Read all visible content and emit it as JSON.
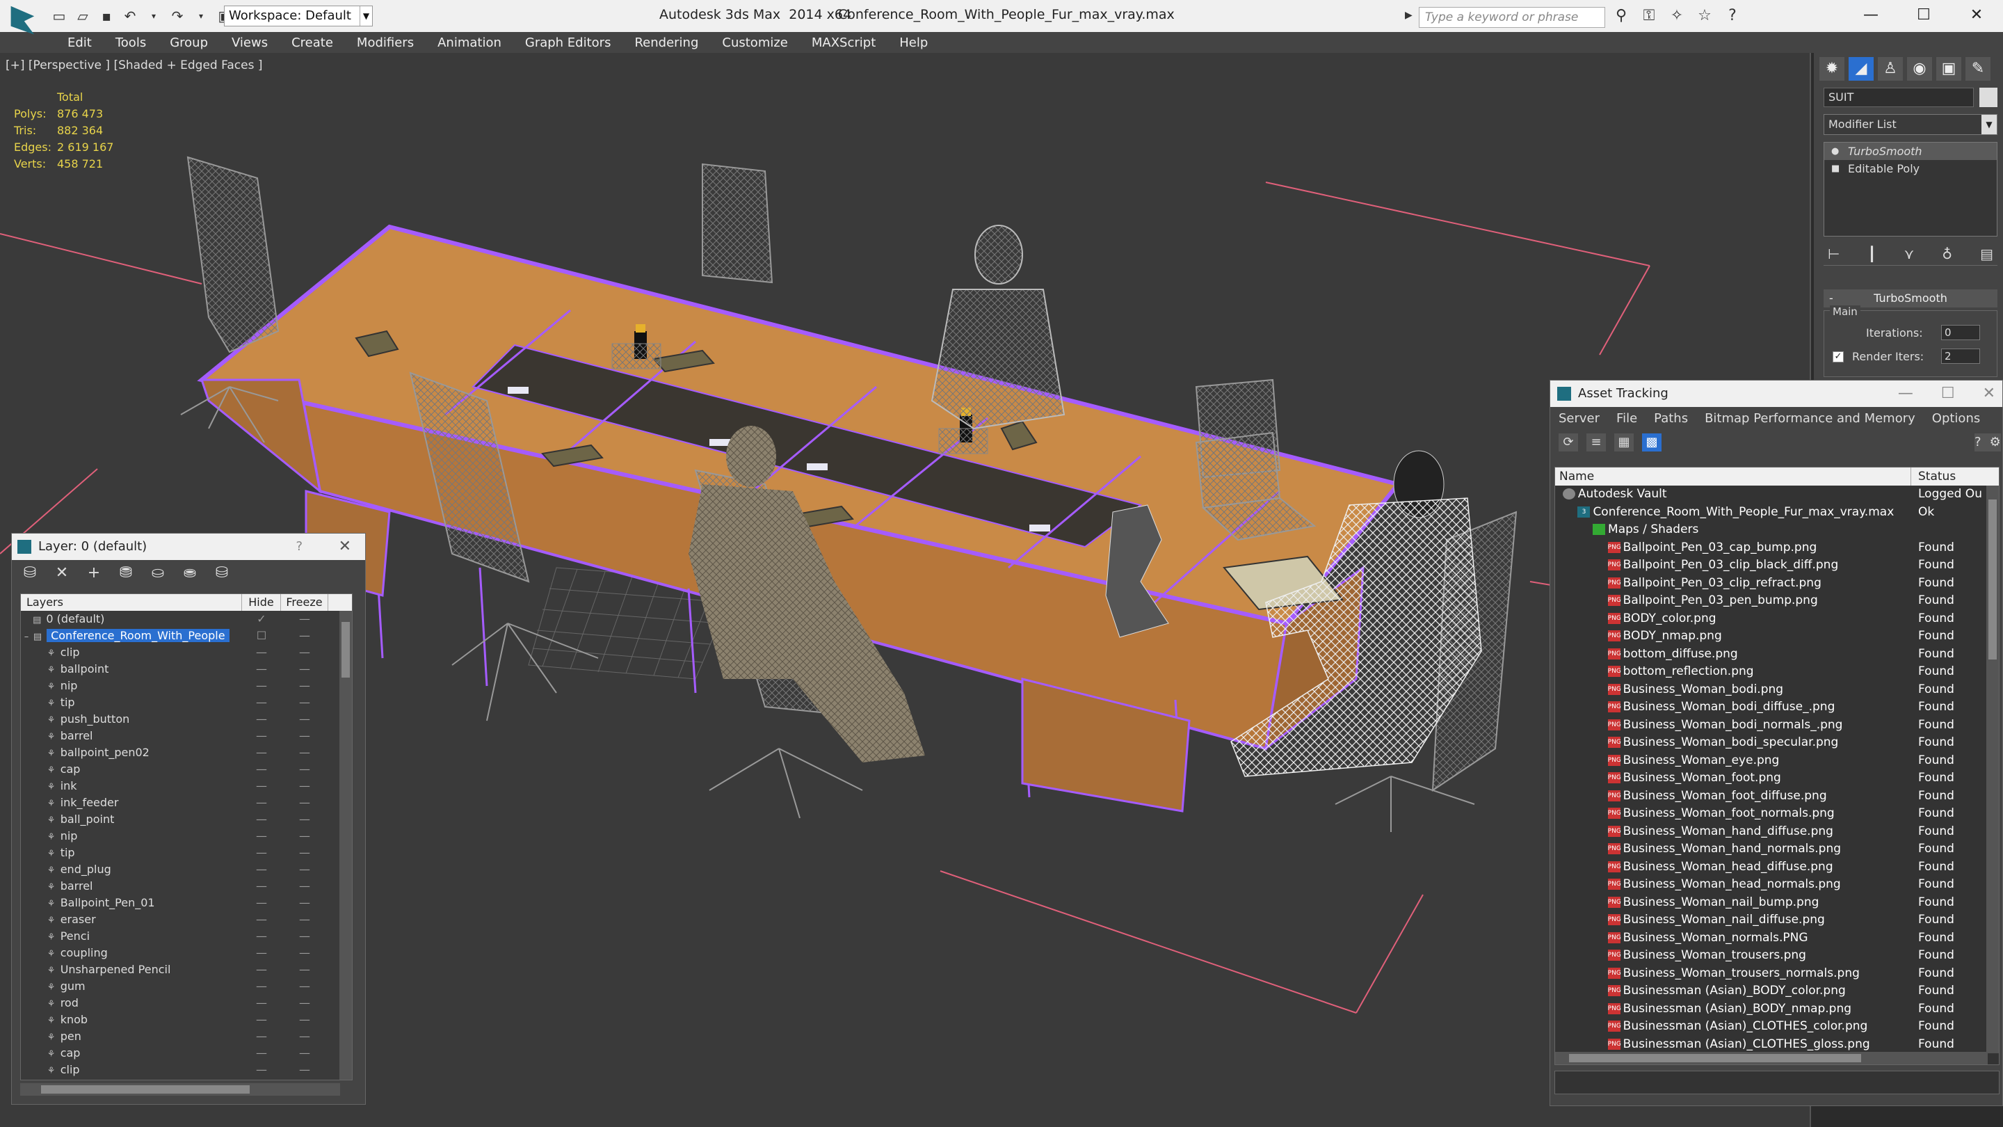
{
  "titlebar": {
    "workspace": "Workspace: Default",
    "app_title": "Autodesk 3ds Max  2014 x64",
    "file_title": "Conference_Room_With_People_Fur_max_vray.max",
    "search_placeholder": "Type a keyword or phrase"
  },
  "menu": [
    "Edit",
    "Tools",
    "Group",
    "Views",
    "Create",
    "Modifiers",
    "Animation",
    "Graph Editors",
    "Rendering",
    "Customize",
    "MAXScript",
    "Help"
  ],
  "viewport": {
    "label": "[+] [Perspective ] [Shaded + Edged Faces ]",
    "stats_header": "Total",
    "stats": [
      {
        "key": "Polys:",
        "value": "876 473"
      },
      {
        "key": "Tris:",
        "value": "882 364"
      },
      {
        "key": "Edges:",
        "value": "2 619 167"
      },
      {
        "key": "Verts:",
        "value": "458 721"
      }
    ]
  },
  "command_panel": {
    "object_name": "SUIT",
    "modifier_list": "Modifier List",
    "stack": [
      "TurboSmooth",
      "Editable Poly"
    ],
    "rollout": "TurboSmooth",
    "group": "Main",
    "iterations_label": "Iterations:",
    "iterations_value": "0",
    "render_iters_label": "Render Iters:",
    "render_iters_value": "2"
  },
  "layer_panel": {
    "title": "Layer: 0 (default)",
    "help": "?",
    "col_layers": "Layers",
    "col_hide": "Hide",
    "col_freeze": "Freeze",
    "default_layer": "0 (default)",
    "selected_layer": "Conference_Room_With_People",
    "items": [
      "clip",
      "ballpoint",
      "nip",
      "tip",
      "push_button",
      "barrel",
      "ballpoint_pen02",
      "cap",
      "ink",
      "ink_feeder",
      "ball_point",
      "nip",
      "tip",
      "end_plug",
      "barrel",
      "Ballpoint_Pen_01",
      "eraser",
      "Penci",
      "coupling",
      "Unsharpened Pencil",
      "gum",
      "rod",
      "knob",
      "pen",
      "cap",
      "clip"
    ]
  },
  "asset_panel": {
    "title": "Asset Tracking",
    "menu": [
      "Server",
      "File",
      "Paths",
      "Bitmap Performance and Memory",
      "Options"
    ],
    "col_name": "Name",
    "col_status": "Status",
    "vault": {
      "name": "Autodesk Vault",
      "status": "Logged Ou"
    },
    "file": {
      "name": "Conference_Room_With_People_Fur_max_vray.max",
      "status": "Ok"
    },
    "maps": "Maps / Shaders",
    "found": "Found",
    "maps_list": [
      "Ballpoint_Pen_03_cap_bump.png",
      "Ballpoint_Pen_03_clip_black_diff.png",
      "Ballpoint_Pen_03_clip_refract.png",
      "Ballpoint_Pen_03_pen_bump.png",
      "BODY_color.png",
      "BODY_nmap.png",
      "bottom_diffuse.png",
      "bottom_reflection.png",
      "Business_Woman_bodi.png",
      "Business_Woman_bodi_diffuse_.png",
      "Business_Woman_bodi_normals_.png",
      "Business_Woman_bodi_specular.png",
      "Business_Woman_eye.png",
      "Business_Woman_foot.png",
      "Business_Woman_foot_diffuse.png",
      "Business_Woman_foot_normals.png",
      "Business_Woman_hand_diffuse.png",
      "Business_Woman_hand_normals.png",
      "Business_Woman_head_diffuse.png",
      "Business_Woman_head_normals.png",
      "Business_Woman_nail_bump.png",
      "Business_Woman_nail_diffuse.png",
      "Business_Woman_normals.PNG",
      "Business_Woman_trousers.png",
      "Business_Woman_trousers_normals.png",
      "Businessman (Asian)_BODY_color.png",
      "Businessman (Asian)_BODY_nmap.png",
      "Businessman (Asian)_CLOTHES_color.png",
      "Businessman (Asian)_CLOTHES_gloss.png"
    ]
  },
  "colors": {
    "selection": "#2a6fd0",
    "stats_text": "#e8d44a",
    "wood": "#c98a47",
    "edge_highlight": "#a55cff"
  }
}
